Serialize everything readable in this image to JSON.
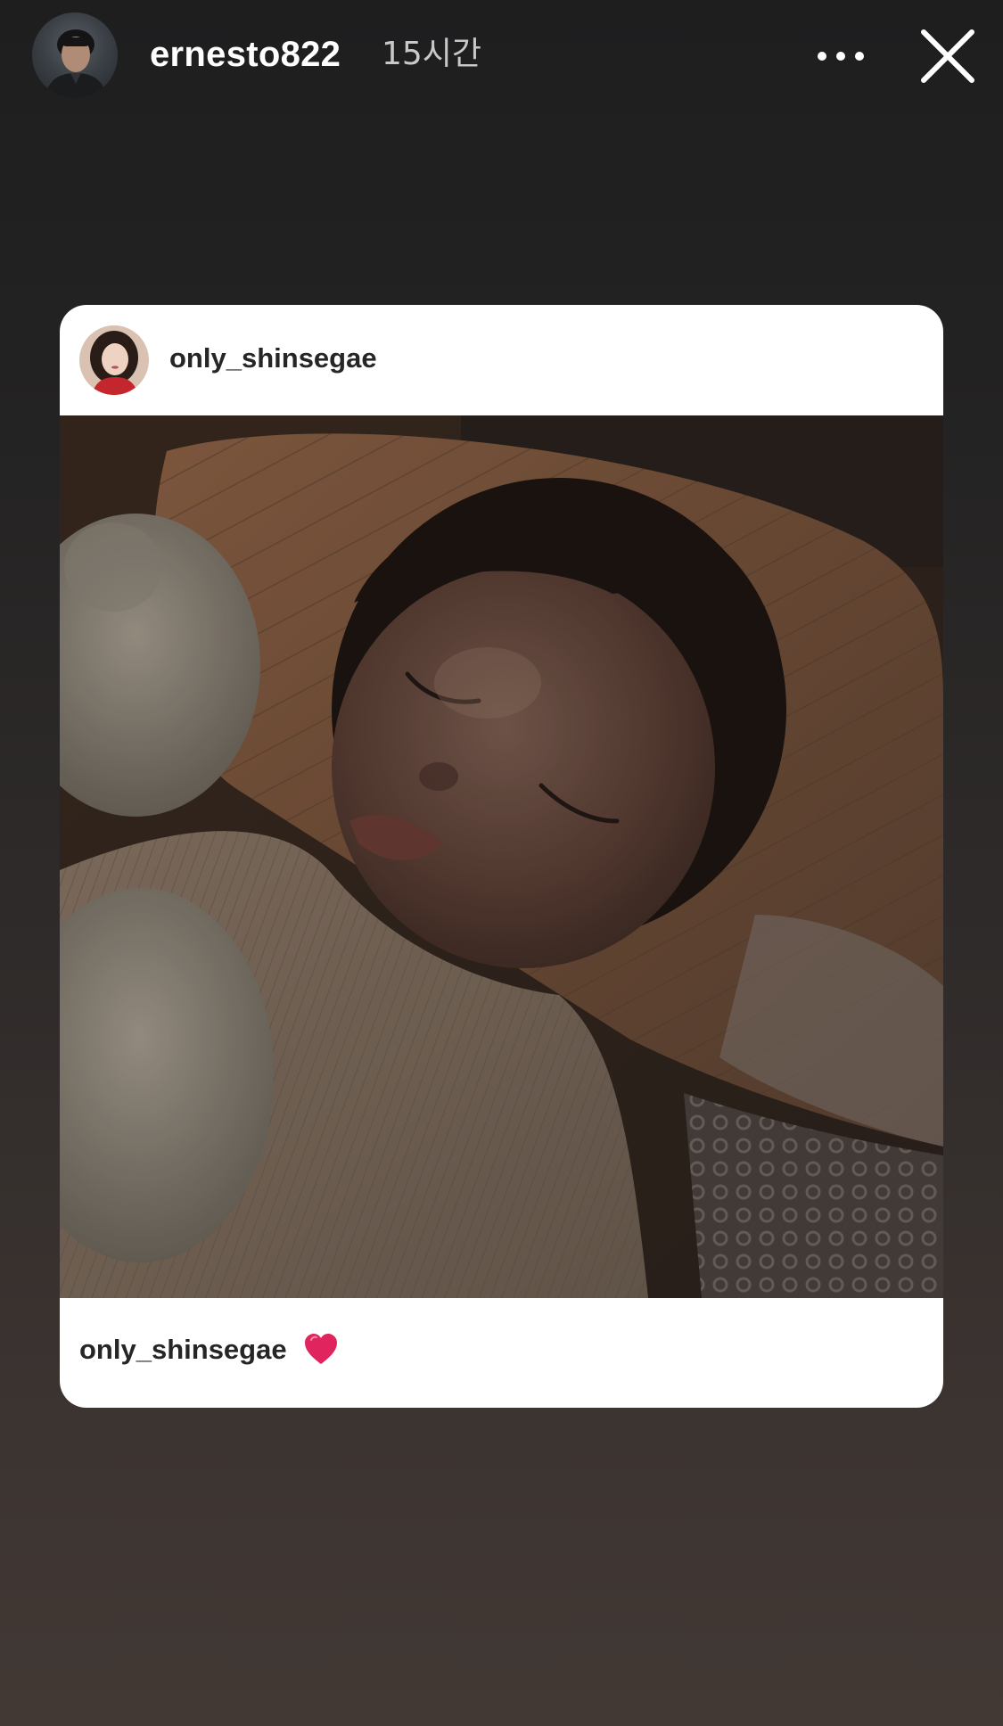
{
  "story": {
    "username": "ernesto822",
    "time_ago": "15시간",
    "icons": {
      "avatar": "profile-photo",
      "more": "more-horizontal-icon",
      "close": "close-icon"
    }
  },
  "shared_post": {
    "author": "only_shinsegae",
    "photo_alt": "sleeping baby on a quilted pillow",
    "caption_user": "only_shinsegae",
    "caption_emoji": "heart-icon",
    "heart_color": "#e0245e"
  },
  "colors": {
    "background_top": "#1e1e1f",
    "background_bottom": "#423935",
    "card": "#ffffff",
    "text_dark": "#262626"
  }
}
